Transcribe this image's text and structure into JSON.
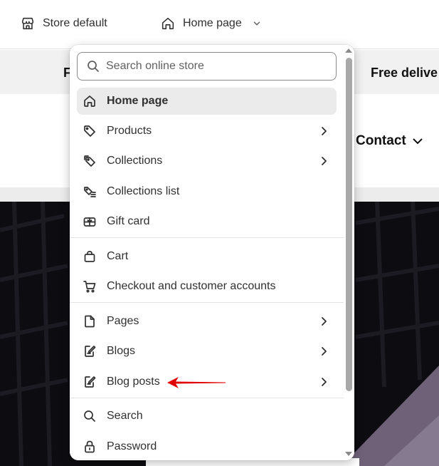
{
  "topbar": {
    "store_label": "Store default",
    "page_label": "Home page"
  },
  "preview": {
    "announcement_left": "F",
    "announcement_right": "Free delive",
    "nav_contact": "Contact"
  },
  "dropdown": {
    "search_placeholder": "Search online store",
    "groups": [
      {
        "items": [
          {
            "label": "Home page",
            "icon": "home-icon",
            "active": true,
            "has_submenu": false
          },
          {
            "label": "Products",
            "icon": "tag-icon",
            "active": false,
            "has_submenu": true
          },
          {
            "label": "Collections",
            "icon": "tags-icon",
            "active": false,
            "has_submenu": true
          },
          {
            "label": "Collections list",
            "icon": "tag-list-icon",
            "active": false,
            "has_submenu": false
          },
          {
            "label": "Gift card",
            "icon": "gift-card-icon",
            "active": false,
            "has_submenu": false
          }
        ]
      },
      {
        "items": [
          {
            "label": "Cart",
            "icon": "bag-icon",
            "active": false,
            "has_submenu": false
          },
          {
            "label": "Checkout and customer accounts",
            "icon": "cart-icon",
            "active": false,
            "has_submenu": false
          }
        ]
      },
      {
        "items": [
          {
            "label": "Pages",
            "icon": "page-icon",
            "active": false,
            "has_submenu": true
          },
          {
            "label": "Blogs",
            "icon": "blog-icon",
            "active": false,
            "has_submenu": true
          },
          {
            "label": "Blog posts",
            "icon": "blog-post-icon",
            "active": false,
            "has_submenu": true
          }
        ]
      },
      {
        "items": [
          {
            "label": "Search",
            "icon": "search-icon",
            "active": false,
            "has_submenu": false
          },
          {
            "label": "Password",
            "icon": "lock-icon",
            "active": false,
            "has_submenu": false
          }
        ]
      }
    ]
  },
  "colors": {
    "active_bg": "#ebebeb",
    "annotation_arrow": "#e00000",
    "text": "#303030"
  }
}
